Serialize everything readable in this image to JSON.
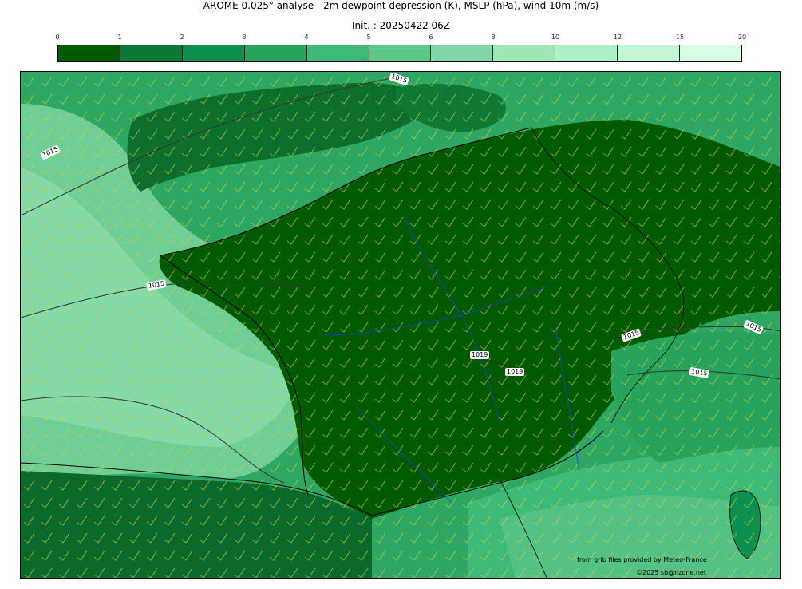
{
  "header": {
    "title": "AROME 0.025° analyse - 2m dewpoint depression (K), MSLP (hPa), wind 10m (m/s)",
    "init": "Init. : 20250422 06Z"
  },
  "colorbar": {
    "ticks": [
      "0",
      "1",
      "2",
      "3",
      "4",
      "5",
      "6",
      "8",
      "10",
      "12",
      "15",
      "20"
    ],
    "colors": [
      "#005a00",
      "#097a35",
      "#0c9050",
      "#27a35d",
      "#3dba78",
      "#5ec68a",
      "#80d6a8",
      "#9ee6b6",
      "#b0f0c8",
      "#c2f7d6",
      "#d7fde5"
    ]
  },
  "isobars": {
    "labels": [
      "1015",
      "1015",
      "1015",
      "1019",
      "1019",
      "1015",
      "1015",
      "1015"
    ]
  },
  "credits": {
    "source": "from grib files provided by Meteo-France",
    "copyright": "©2025 sb@nzone.net"
  },
  "colors": {
    "land_dry": "#005a00",
    "sea_moist": "#5ec68a",
    "wind_barb": "#d4d22c",
    "coast": "#000000",
    "river": "#2a3bd4"
  }
}
